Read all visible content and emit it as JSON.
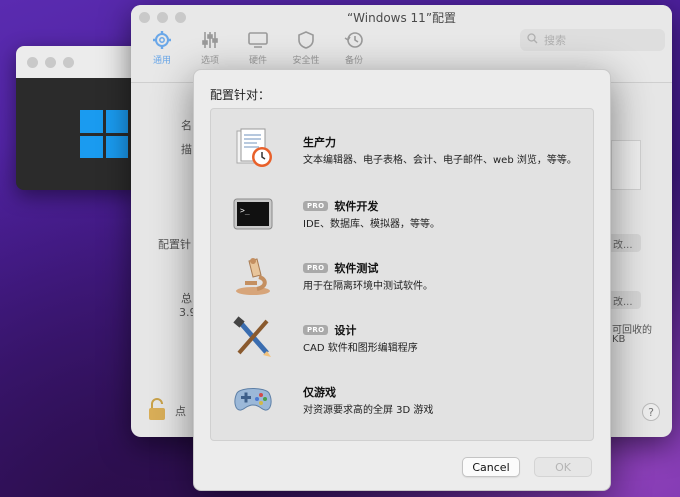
{
  "vm_window": {
    "logo_color": "#1a9bf0"
  },
  "config_window": {
    "title": "“Windows 11”配置",
    "toolbar": [
      {
        "label": "通用",
        "icon": "gear-icon",
        "active": true
      },
      {
        "label": "选项",
        "icon": "sliders-icon"
      },
      {
        "label": "硬件",
        "icon": "display-icon"
      },
      {
        "label": "安全性",
        "icon": "shield-icon"
      },
      {
        "label": "备份",
        "icon": "clock-icon"
      }
    ],
    "search_placeholder": "搜索",
    "partial_labels": {
      "name": "名",
      "desc": "描",
      "config_for": "配置针",
      "total": "总",
      "size": "3.9",
      "btn1": "改...",
      "btn2": "改...",
      "reclaim": "可回收的",
      "kb": "KB",
      "lock": "点"
    },
    "help": "?"
  },
  "sheet": {
    "heading": "配置针对：",
    "items": [
      {
        "name": "生产力",
        "pro": "",
        "desc": "文本编辑器、电子表格、会计、电子邮件、web 浏览，等等。",
        "icon": "productivity-icon"
      },
      {
        "name": "软件开发",
        "pro": "PRO",
        "desc": "IDE、数据库、模拟器，等等。",
        "icon": "terminal-icon"
      },
      {
        "name": "软件测试",
        "pro": "PRO",
        "desc": "用于在隔离环境中测试软件。",
        "icon": "microscope-icon"
      },
      {
        "name": "设计",
        "pro": "PRO",
        "desc": "CAD 软件和图形编辑程序",
        "icon": "design-tools-icon"
      },
      {
        "name": "仅游戏",
        "pro": "",
        "desc": "对资源要求高的全屏 3D 游戏",
        "icon": "gamepad-icon"
      }
    ],
    "cancel_label": "Cancel",
    "ok_label": "OK"
  }
}
